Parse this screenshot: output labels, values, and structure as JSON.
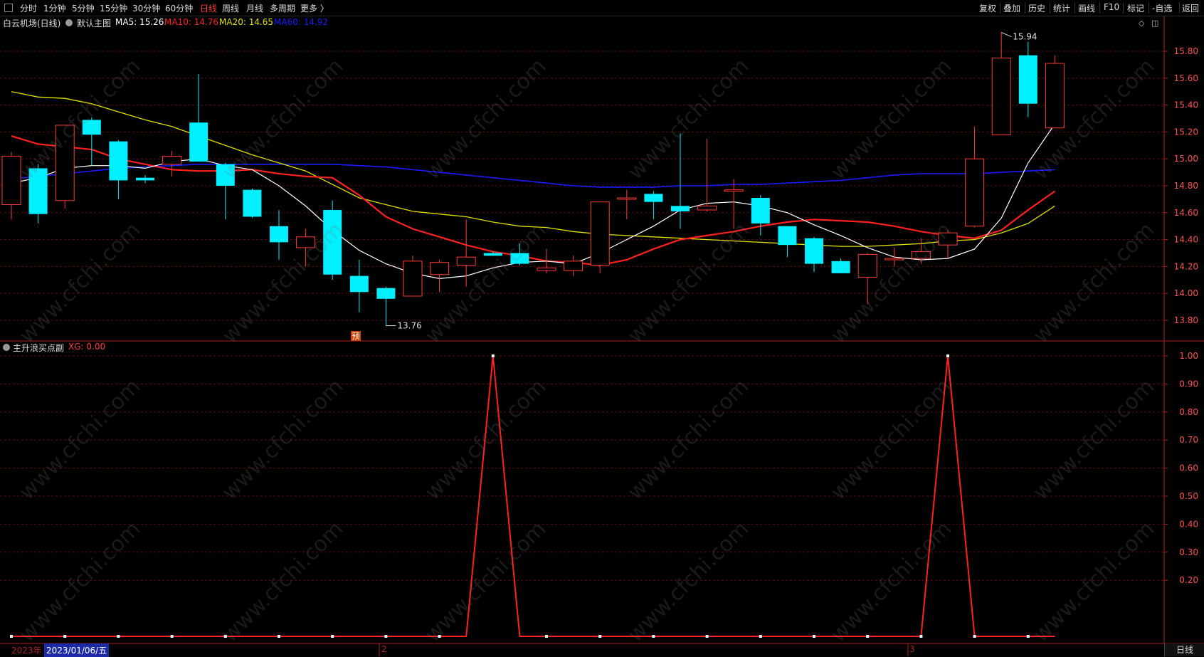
{
  "toolbar": {
    "tabs": [
      "分时",
      "1分钟",
      "5分钟",
      "15分钟",
      "30分钟",
      "60分钟",
      "日线",
      "周线",
      "月线",
      "多周期",
      "更多 〉"
    ],
    "active_tab": "日线",
    "tools": [
      "复权",
      "叠加",
      "历史",
      "统计",
      "画线",
      "F10",
      "标记",
      "-自选",
      "返回"
    ]
  },
  "main": {
    "title": "白云机场(日线)",
    "template": "默认主图",
    "ma5": "MA5: 15.26",
    "ma10": "MA10: 14.76",
    "ma20": "MA20: 14.65",
    "ma60": "MA60: 14.92",
    "high_marker": "15.94",
    "low_marker": "13.76",
    "forecast_badge": "预"
  },
  "indicator": {
    "title": "主升浪买点副",
    "xg": "XG: 0.00"
  },
  "datebar": {
    "year": "2023年",
    "cursor_date": "2023/01/06/五",
    "month_a": "2",
    "month_b": "3",
    "period_button": "日线"
  },
  "watermark": "www.cfchi.com",
  "colors": {
    "up": "#ff3a3a",
    "down": "#00f0ff",
    "ma5": "#ffffff",
    "ma10": "#ff2020",
    "ma20": "#e0e000",
    "ma60": "#1a1aff",
    "axis": "#b02020",
    "grid": "#5a0d0d"
  },
  "chart_data": [
    {
      "type": "candlestick",
      "title": "白云机场(日线)",
      "y_ticks": [
        15.8,
        15.6,
        15.4,
        15.2,
        15.0,
        14.8,
        14.6,
        14.4,
        14.2,
        14.0,
        13.8
      ],
      "ylim": [
        13.72,
        16.02
      ],
      "candles": [
        {
          "o": 14.66,
          "h": 15.05,
          "l": 14.55,
          "c": 15.02
        },
        {
          "o": 14.93,
          "h": 14.96,
          "l": 14.52,
          "c": 14.59
        },
        {
          "o": 14.69,
          "h": 15.25,
          "l": 14.63,
          "c": 15.25
        },
        {
          "o": 15.29,
          "h": 15.31,
          "l": 14.95,
          "c": 15.18
        },
        {
          "o": 15.13,
          "h": 15.14,
          "l": 14.7,
          "c": 14.84
        },
        {
          "o": 14.86,
          "h": 14.88,
          "l": 14.82,
          "c": 14.84
        },
        {
          "o": 14.96,
          "h": 15.06,
          "l": 14.87,
          "c": 15.02
        },
        {
          "o": 15.27,
          "h": 15.63,
          "l": 14.98,
          "c": 14.98
        },
        {
          "o": 14.96,
          "h": 14.97,
          "l": 14.55,
          "c": 14.8
        },
        {
          "o": 14.77,
          "h": 14.78,
          "l": 14.56,
          "c": 14.57
        },
        {
          "o": 14.5,
          "h": 14.62,
          "l": 14.25,
          "c": 14.38
        },
        {
          "o": 14.34,
          "h": 14.48,
          "l": 14.2,
          "c": 14.42
        },
        {
          "o": 14.62,
          "h": 14.69,
          "l": 14.1,
          "c": 14.14
        },
        {
          "o": 14.13,
          "h": 14.25,
          "l": 13.86,
          "c": 14.01
        },
        {
          "o": 14.04,
          "h": 14.05,
          "l": 13.76,
          "c": 13.96
        },
        {
          "o": 13.98,
          "h": 14.28,
          "l": 13.98,
          "c": 14.24
        },
        {
          "o": 14.14,
          "h": 14.25,
          "l": 14.01,
          "c": 14.23
        },
        {
          "o": 14.21,
          "h": 14.55,
          "l": 14.05,
          "c": 14.27
        },
        {
          "o": 14.3,
          "h": 14.31,
          "l": 14.28,
          "c": 14.28
        },
        {
          "o": 14.3,
          "h": 14.37,
          "l": 14.21,
          "c": 14.22
        },
        {
          "o": 14.17,
          "h": 14.33,
          "l": 14.15,
          "c": 14.19
        },
        {
          "o": 14.17,
          "h": 14.28,
          "l": 14.13,
          "c": 14.24
        },
        {
          "o": 14.21,
          "h": 14.68,
          "l": 14.15,
          "c": 14.68
        },
        {
          "o": 14.71,
          "h": 14.77,
          "l": 14.55,
          "c": 14.71
        },
        {
          "o": 14.74,
          "h": 14.76,
          "l": 14.55,
          "c": 14.68
        },
        {
          "o": 14.65,
          "h": 15.19,
          "l": 14.48,
          "c": 14.61
        },
        {
          "o": 14.62,
          "h": 15.15,
          "l": 14.61,
          "c": 14.65
        },
        {
          "o": 14.77,
          "h": 14.85,
          "l": 14.48,
          "c": 14.77
        },
        {
          "o": 14.71,
          "h": 14.73,
          "l": 14.43,
          "c": 14.52
        },
        {
          "o": 14.5,
          "h": 14.5,
          "l": 14.27,
          "c": 14.36
        },
        {
          "o": 14.41,
          "h": 14.42,
          "l": 14.16,
          "c": 14.22
        },
        {
          "o": 14.24,
          "h": 14.26,
          "l": 14.15,
          "c": 14.15
        },
        {
          "o": 14.12,
          "h": 14.3,
          "l": 13.92,
          "c": 14.29
        },
        {
          "o": 14.25,
          "h": 14.34,
          "l": 14.2,
          "c": 14.26
        },
        {
          "o": 14.26,
          "h": 14.41,
          "l": 14.22,
          "c": 14.31
        },
        {
          "o": 14.36,
          "h": 14.47,
          "l": 14.26,
          "c": 14.45
        },
        {
          "o": 14.5,
          "h": 15.24,
          "l": 14.49,
          "c": 15.0
        },
        {
          "o": 15.18,
          "h": 15.94,
          "l": 15.18,
          "c": 15.75
        },
        {
          "o": 15.77,
          "h": 15.87,
          "l": 15.31,
          "c": 15.41
        },
        {
          "o": 15.23,
          "h": 15.77,
          "l": 15.23,
          "c": 15.71
        }
      ],
      "ma5": [
        14.82,
        14.86,
        14.93,
        14.95,
        14.95,
        14.93,
        14.98,
        15.0,
        14.95,
        14.92,
        14.8,
        14.65,
        14.47,
        14.32,
        14.22,
        14.15,
        14.11,
        14.13,
        14.19,
        14.23,
        14.24,
        14.22,
        14.3,
        14.4,
        14.5,
        14.62,
        14.67,
        14.68,
        14.65,
        14.6,
        14.51,
        14.43,
        14.34,
        14.27,
        14.25,
        14.26,
        14.33,
        14.56,
        14.97,
        15.26
      ],
      "ma10": [
        15.17,
        15.11,
        15.09,
        15.07,
        15.0,
        14.96,
        14.92,
        14.91,
        14.91,
        14.92,
        14.89,
        14.87,
        14.86,
        14.73,
        14.57,
        14.48,
        14.42,
        14.36,
        14.31,
        14.28,
        14.24,
        14.23,
        14.21,
        14.25,
        14.33,
        14.4,
        14.43,
        14.46,
        14.5,
        14.53,
        14.55,
        14.54,
        14.53,
        14.5,
        14.46,
        14.43,
        14.41,
        14.47,
        14.62,
        14.76
      ],
      "ma20": [
        15.5,
        15.46,
        15.45,
        15.41,
        15.35,
        15.29,
        15.24,
        15.17,
        15.1,
        15.03,
        14.97,
        14.91,
        14.81,
        14.71,
        14.66,
        14.61,
        14.59,
        14.57,
        14.53,
        14.5,
        14.49,
        14.46,
        14.44,
        14.43,
        14.42,
        14.41,
        14.4,
        14.39,
        14.38,
        14.37,
        14.36,
        14.35,
        14.35,
        14.36,
        14.37,
        14.39,
        14.4,
        14.45,
        14.52,
        14.65
      ],
      "ma60": [
        14.85,
        14.87,
        14.89,
        14.91,
        14.93,
        14.94,
        14.95,
        14.96,
        14.96,
        14.96,
        14.96,
        14.96,
        14.96,
        14.95,
        14.94,
        14.92,
        14.9,
        14.88,
        14.86,
        14.84,
        14.82,
        14.8,
        14.79,
        14.79,
        14.79,
        14.8,
        14.8,
        14.81,
        14.81,
        14.82,
        14.83,
        14.84,
        14.86,
        14.88,
        14.89,
        14.89,
        14.89,
        14.9,
        14.91,
        14.92
      ]
    },
    {
      "type": "line",
      "title": "主升浪买点副",
      "y_ticks": [
        1.0,
        0.9,
        0.8,
        0.7,
        0.6,
        0.5,
        0.4,
        0.3,
        0.2
      ],
      "ylim": [
        -0.02,
        1.02
      ],
      "values": [
        0,
        0,
        0,
        0,
        0,
        0,
        0,
        0,
        0,
        0,
        0,
        0,
        0,
        0,
        0,
        0,
        0,
        0,
        1,
        0,
        0,
        0,
        0,
        0,
        0,
        0,
        0,
        0,
        0,
        0,
        0,
        0,
        0,
        0,
        0,
        1,
        0,
        0,
        0,
        0
      ]
    }
  ]
}
